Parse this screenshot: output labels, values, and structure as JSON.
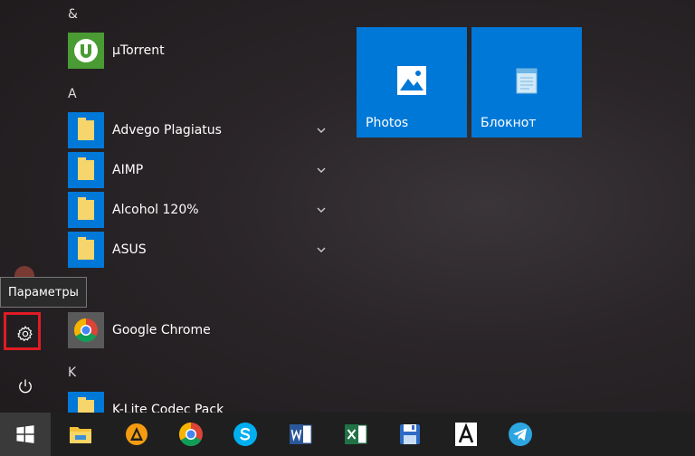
{
  "tooltip": "Параметры",
  "app_list": {
    "groups": [
      {
        "letter": "&"
      },
      {
        "letter": "A"
      },
      {
        "letter": "K"
      }
    ],
    "apps": [
      {
        "label": "µTorrent",
        "icon": "utorrent-icon"
      },
      {
        "label": "Advego Plagiatus",
        "icon": "folder-icon"
      },
      {
        "label": "AIMP",
        "icon": "folder-icon"
      },
      {
        "label": "Alcohol 120%",
        "icon": "folder-icon"
      },
      {
        "label": "ASUS",
        "icon": "folder-icon"
      },
      {
        "label": "Google Chrome",
        "icon": "chrome-icon"
      },
      {
        "label": "K-Lite Codec Pack",
        "icon": "folder-icon"
      }
    ]
  },
  "tiles": [
    {
      "label": "Photos",
      "icon": "photos-icon"
    },
    {
      "label": "Блокнот",
      "icon": "notepad-icon"
    }
  ],
  "taskbar": {
    "items": [
      "start-icon",
      "file-explorer-icon",
      "aimp-icon",
      "chrome-icon",
      "skype-icon",
      "word-icon",
      "excel-icon",
      "floppy-icon",
      "font-icon",
      "telegram-icon"
    ]
  },
  "colors": {
    "accent": "#0078d7",
    "highlight": "#e01b24",
    "taskbar": "#1f1f1f"
  }
}
